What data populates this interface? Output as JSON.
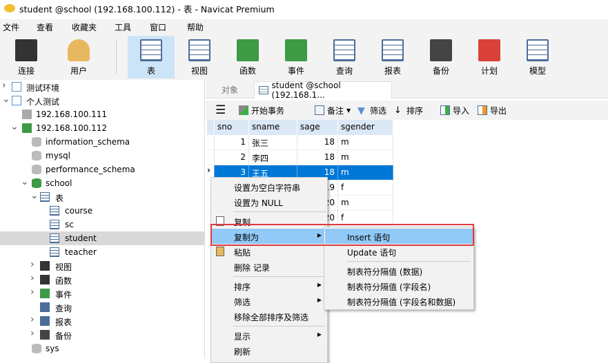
{
  "window": {
    "title": "student @school (192.168.100.112) - 表 - Navicat Premium"
  },
  "menu": [
    "文件",
    "查看",
    "收藏夹",
    "工具",
    "窗口",
    "帮助"
  ],
  "toolbar": [
    {
      "label": "连接",
      "icon": "connection-icon",
      "color": "#333333"
    },
    {
      "label": "用户",
      "icon": "user-icon",
      "color": "#e8b860"
    },
    {
      "label": "表",
      "icon": "table-icon",
      "color": "#4a6d9a",
      "active": true
    },
    {
      "label": "视图",
      "icon": "view-icon",
      "color": "#4a6d9a"
    },
    {
      "label": "函数",
      "icon": "function-icon",
      "color": "#3d9a45"
    },
    {
      "label": "事件",
      "icon": "event-icon",
      "color": "#3d9a45"
    },
    {
      "label": "查询",
      "icon": "query-icon",
      "color": "#4a6d9a"
    },
    {
      "label": "报表",
      "icon": "report-icon",
      "color": "#4a6d9a"
    },
    {
      "label": "备份",
      "icon": "backup-icon",
      "color": "#444444"
    },
    {
      "label": "计划",
      "icon": "schedule-icon",
      "color": "#d9413a"
    },
    {
      "label": "模型",
      "icon": "model-icon",
      "color": "#4a6d9a"
    }
  ],
  "tree": [
    {
      "label": "测试环境",
      "level": 0,
      "arrow": ">",
      "icon": "folder-icon",
      "color": "#5b8fcf"
    },
    {
      "label": "个人测试",
      "level": 0,
      "arrow": "v",
      "icon": "folder-icon",
      "color": "#5b8fcf"
    },
    {
      "label": "192.168.100.111",
      "level": 1,
      "arrow": "",
      "icon": "connection-icon",
      "color": "#aaaaaa"
    },
    {
      "label": "192.168.100.112",
      "level": 1,
      "arrow": "v",
      "icon": "connection-icon",
      "color": "#3d9a45"
    },
    {
      "label": "information_schema",
      "level": 2,
      "arrow": "",
      "icon": "database-icon",
      "color": "#bbbbbb"
    },
    {
      "label": "mysql",
      "level": 2,
      "arrow": "",
      "icon": "database-icon",
      "color": "#bbbbbb"
    },
    {
      "label": "performance_schema",
      "level": 2,
      "arrow": "",
      "icon": "database-icon",
      "color": "#bbbbbb"
    },
    {
      "label": "school",
      "level": 2,
      "arrow": "v",
      "icon": "database-icon",
      "color": "#3d9a45"
    },
    {
      "label": "表",
      "level": 3,
      "arrow": "v",
      "icon": "table-icon",
      "color": "#4a6d9a"
    },
    {
      "label": "course",
      "level": 4,
      "arrow": "",
      "icon": "table-icon",
      "color": "#4a6d9a"
    },
    {
      "label": "sc",
      "level": 4,
      "arrow": "",
      "icon": "table-icon",
      "color": "#4a6d9a"
    },
    {
      "label": "student",
      "level": 4,
      "arrow": "",
      "icon": "table-icon",
      "color": "#4a6d9a",
      "selected": true
    },
    {
      "label": "teacher",
      "level": 4,
      "arrow": "",
      "icon": "table-icon",
      "color": "#4a6d9a"
    },
    {
      "label": "视图",
      "level": 3,
      "arrow": ">",
      "icon": "view-icon",
      "color": "#333333"
    },
    {
      "label": "函数",
      "level": 3,
      "arrow": ">",
      "icon": "function-icon",
      "color": "#333333"
    },
    {
      "label": "事件",
      "level": 3,
      "arrow": ">",
      "icon": "event-icon",
      "color": "#3d9a45"
    },
    {
      "label": "查询",
      "level": 3,
      "arrow": "",
      "icon": "query-icon",
      "color": "#4a6d9a"
    },
    {
      "label": "报表",
      "level": 3,
      "arrow": ">",
      "icon": "report-icon",
      "color": "#4a6d9a"
    },
    {
      "label": "备份",
      "level": 3,
      "arrow": ">",
      "icon": "backup-icon",
      "color": "#444444"
    },
    {
      "label": "sys",
      "level": 2,
      "arrow": "",
      "icon": "database-icon",
      "color": "#bbbbbb"
    }
  ],
  "tabs": {
    "objects": "对象",
    "active": "student @school (192.168.1..."
  },
  "gridtools": {
    "begin_tx": "开始事务",
    "note": "备注",
    "filter": "筛选",
    "sort": "排序",
    "import": "导入",
    "export": "导出"
  },
  "grid": {
    "columns": [
      "sno",
      "sname",
      "sage",
      "sgender"
    ],
    "rows": [
      [
        "1",
        "张三",
        "18",
        "m"
      ],
      [
        "2",
        "李四",
        "18",
        "m"
      ],
      [
        "3",
        "王五",
        "18",
        "m"
      ],
      [
        "",
        "",
        "19",
        "f"
      ],
      [
        "",
        "",
        "20",
        "m"
      ],
      [
        "",
        "",
        "20",
        "f"
      ]
    ],
    "selected_row": 2
  },
  "context_menu": [
    {
      "label": "设置为空白字符串"
    },
    {
      "label": "设置为 NULL"
    },
    {
      "sep": true
    },
    {
      "label": "复制",
      "icon": "copy-icon"
    },
    {
      "label": "复制为",
      "submenu": true,
      "highlight": true
    },
    {
      "label": "粘贴",
      "icon": "paste-icon"
    },
    {
      "label": "删除 记录"
    },
    {
      "sep": true
    },
    {
      "label": "排序",
      "submenu": true
    },
    {
      "label": "筛选",
      "submenu": true
    },
    {
      "label": "移除全部排序及筛选"
    },
    {
      "sep": true
    },
    {
      "label": "显示",
      "submenu": true
    },
    {
      "label": "刷新"
    }
  ],
  "submenu": [
    {
      "label": "Insert 语句",
      "highlight": true
    },
    {
      "label": "Update 语句"
    },
    {
      "sep": true
    },
    {
      "label": "制表符分隔值 (数据)"
    },
    {
      "label": "制表符分隔值 (字段名)"
    },
    {
      "label": "制表符分隔值 (字段名和数据)"
    }
  ],
  "colors": {
    "highlight": "#91c9f7",
    "selection": "#0078d7",
    "annotation": "#e0393e"
  }
}
